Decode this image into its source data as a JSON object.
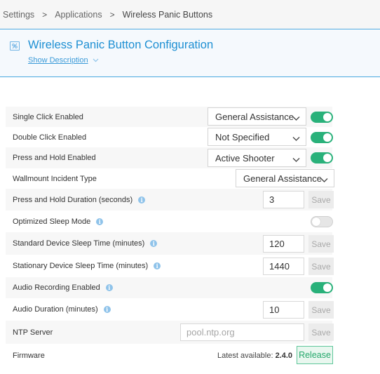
{
  "breadcrumb": {
    "items": [
      "Settings",
      "Applications",
      "Wireless Panic Buttons"
    ],
    "separator": ">"
  },
  "header": {
    "title": "Wireless Panic Button Configuration",
    "show_description": "Show Description"
  },
  "settings": {
    "single_click": {
      "label": "Single Click Enabled",
      "value": "General Assistance",
      "enabled": true
    },
    "double_click": {
      "label": "Double Click Enabled",
      "value": "Not Specified",
      "enabled": true
    },
    "press_hold": {
      "label": "Press and Hold Enabled",
      "value": "Active Shooter",
      "enabled": true
    },
    "wallmount": {
      "label": "Wallmount Incident Type",
      "value": "General Assistance"
    },
    "press_hold_duration": {
      "label": "Press and Hold Duration (seconds)",
      "value": "3",
      "save": "Save"
    },
    "optimized_sleep": {
      "label": "Optimized Sleep Mode",
      "enabled": false
    },
    "standard_sleep": {
      "label": "Standard Device Sleep Time (minutes)",
      "value": "120",
      "save": "Save"
    },
    "stationary_sleep": {
      "label": "Stationary Device Sleep Time (minutes)",
      "value": "1440",
      "save": "Save"
    },
    "audio_recording": {
      "label": "Audio Recording Enabled",
      "enabled": true
    },
    "audio_duration": {
      "label": "Audio Duration (minutes)",
      "value": "10",
      "save": "Save"
    },
    "ntp_server": {
      "label": "NTP Server",
      "placeholder": "pool.ntp.org",
      "save": "Save"
    },
    "firmware": {
      "label": "Firmware",
      "latest_prefix": "Latest available:",
      "latest_version": "2.4.0",
      "release": "Release"
    }
  },
  "colors": {
    "accent": "#1d8fd3",
    "toggle_on": "#29b17a",
    "release_green": "#24a86b"
  }
}
